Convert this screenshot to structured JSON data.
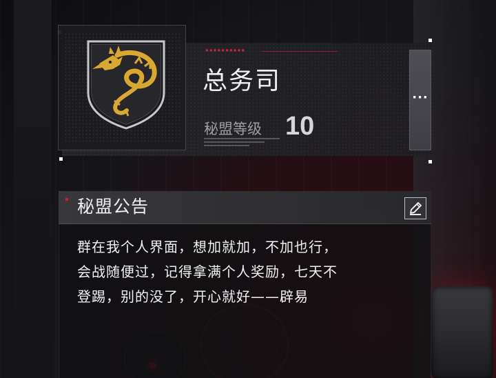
{
  "guild": {
    "name": "总务司",
    "level_label": "秘盟等级",
    "level_value": "10",
    "more_label": "···"
  },
  "announcement": {
    "title": "秘盟公告",
    "body": "群在我个人界面，想加就加，不加也行，\n会战随便过，记得拿满个人奖励，七天不\n登踢，别的没了，开心就好——辟易"
  },
  "icons": {
    "emblem": "golden-dragon-shield-icon",
    "edit": "pencil-icon",
    "more": "ellipsis-icon"
  },
  "colors": {
    "accent_red": "#e0182e",
    "dragon_gold": "#d9a832",
    "panel_dark": "#101013"
  }
}
